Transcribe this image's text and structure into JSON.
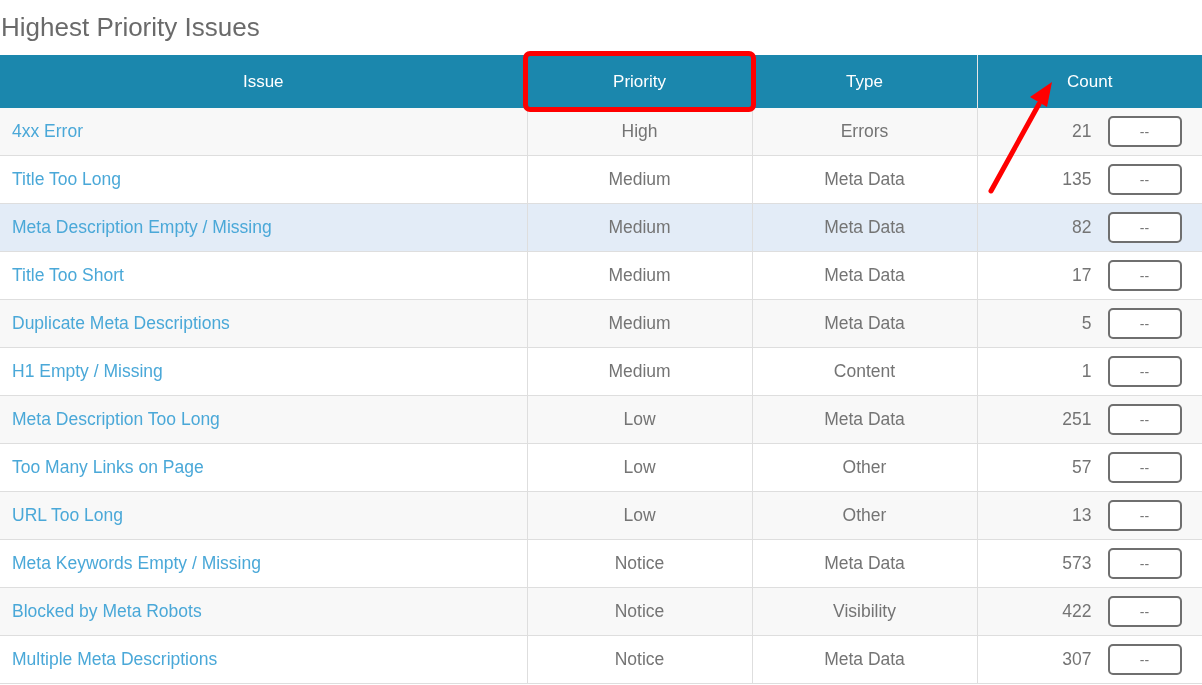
{
  "title": "Highest Priority Issues",
  "table": {
    "columns": [
      {
        "label": "Issue",
        "boxed": false,
        "arrow": false
      },
      {
        "label": "Priority",
        "boxed": true,
        "arrow": false
      },
      {
        "label": "Type",
        "boxed": false,
        "arrow": false
      },
      {
        "label": "Count",
        "boxed": false,
        "arrow": true
      }
    ],
    "rows": [
      {
        "issue": "4xx Error",
        "priority": "High",
        "type": "Errors",
        "count": "21",
        "action": "--",
        "highlighted": false
      },
      {
        "issue": "Title Too Long",
        "priority": "Medium",
        "type": "Meta Data",
        "count": "135",
        "action": "--",
        "highlighted": false
      },
      {
        "issue": "Meta Description Empty / Missing",
        "priority": "Medium",
        "type": "Meta Data",
        "count": "82",
        "action": "--",
        "highlighted": true
      },
      {
        "issue": "Title Too Short",
        "priority": "Medium",
        "type": "Meta Data",
        "count": "17",
        "action": "--",
        "highlighted": false
      },
      {
        "issue": "Duplicate Meta Descriptions",
        "priority": "Medium",
        "type": "Meta Data",
        "count": "5",
        "action": "--",
        "highlighted": false
      },
      {
        "issue": "H1 Empty / Missing",
        "priority": "Medium",
        "type": "Content",
        "count": "1",
        "action": "--",
        "highlighted": false
      },
      {
        "issue": "Meta Description Too Long",
        "priority": "Low",
        "type": "Meta Data",
        "count": "251",
        "action": "--",
        "highlighted": false
      },
      {
        "issue": "Too Many Links on Page",
        "priority": "Low",
        "type": "Other",
        "count": "57",
        "action": "--",
        "highlighted": false
      },
      {
        "issue": "URL Too Long",
        "priority": "Low",
        "type": "Other",
        "count": "13",
        "action": "--",
        "highlighted": false
      },
      {
        "issue": "Meta Keywords Empty / Missing",
        "priority": "Notice",
        "type": "Meta Data",
        "count": "573",
        "action": "--",
        "highlighted": false
      },
      {
        "issue": "Blocked by Meta Robots",
        "priority": "Notice",
        "type": "Visibility",
        "count": "422",
        "action": "--",
        "highlighted": false
      },
      {
        "issue": "Multiple Meta Descriptions",
        "priority": "Notice",
        "type": "Meta Data",
        "count": "307",
        "action": "--",
        "highlighted": false
      }
    ]
  }
}
